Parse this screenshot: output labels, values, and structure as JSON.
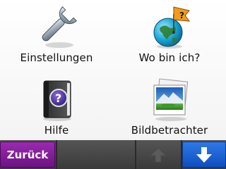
{
  "menu": {
    "items": [
      {
        "label": "Einstellungen",
        "icon": "wrench-icon"
      },
      {
        "label": "Wo bin ich?",
        "icon": "globe-flag-question-icon"
      },
      {
        "label": "Hilfe",
        "icon": "help-book-icon"
      },
      {
        "label": "Bildbetrachter",
        "icon": "photo-viewer-icon"
      }
    ]
  },
  "bottombar": {
    "back_label": "Zurück",
    "up_icon": "arrow-up-icon",
    "down_icon": "arrow-down-icon"
  },
  "colors": {
    "back_button": "#7b1a93",
    "down_button": "#1a5fd6",
    "bar": "#444444",
    "flag": "#f29b1a"
  }
}
